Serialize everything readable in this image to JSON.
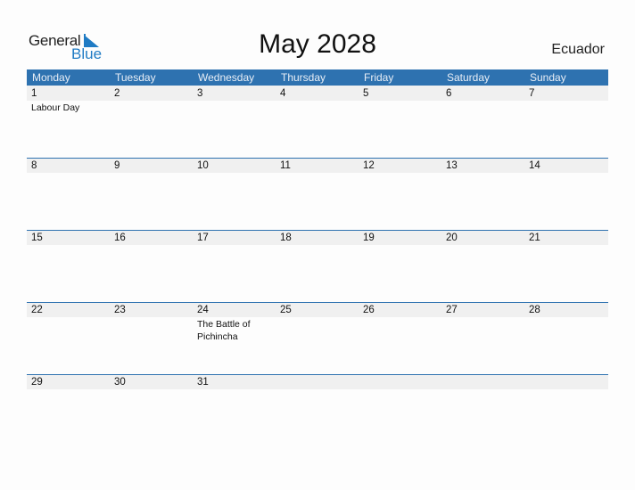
{
  "logo": {
    "word1": "General",
    "word2": "Blue"
  },
  "title": "May 2028",
  "country": "Ecuador",
  "colors": {
    "header_bg": "#2e72b0",
    "date_strip": "#f0f0f0",
    "logo_blue": "#1f7bc4"
  },
  "weekdays": [
    "Monday",
    "Tuesday",
    "Wednesday",
    "Thursday",
    "Friday",
    "Saturday",
    "Sunday"
  ],
  "weeks": [
    [
      {
        "day": "1",
        "holiday": "Labour Day"
      },
      {
        "day": "2"
      },
      {
        "day": "3"
      },
      {
        "day": "4"
      },
      {
        "day": "5"
      },
      {
        "day": "6"
      },
      {
        "day": "7"
      }
    ],
    [
      {
        "day": "8"
      },
      {
        "day": "9"
      },
      {
        "day": "10"
      },
      {
        "day": "11"
      },
      {
        "day": "12"
      },
      {
        "day": "13"
      },
      {
        "day": "14"
      }
    ],
    [
      {
        "day": "15"
      },
      {
        "day": "16"
      },
      {
        "day": "17"
      },
      {
        "day": "18"
      },
      {
        "day": "19"
      },
      {
        "day": "20"
      },
      {
        "day": "21"
      }
    ],
    [
      {
        "day": "22"
      },
      {
        "day": "23"
      },
      {
        "day": "24",
        "holiday": "The Battle of Pichincha"
      },
      {
        "day": "25"
      },
      {
        "day": "26"
      },
      {
        "day": "27"
      },
      {
        "day": "28"
      }
    ],
    [
      {
        "day": "29"
      },
      {
        "day": "30"
      },
      {
        "day": "31"
      },
      {
        "day": ""
      },
      {
        "day": ""
      },
      {
        "day": ""
      },
      {
        "day": ""
      }
    ]
  ]
}
